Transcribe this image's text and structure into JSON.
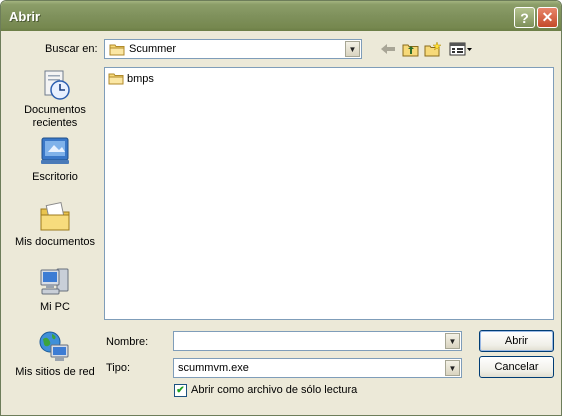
{
  "window": {
    "title": "Abrir"
  },
  "toolbar": {
    "look_in_label": "Buscar en:",
    "look_in_value": "Scummer"
  },
  "places": [
    {
      "label_line1": "Documentos",
      "label_line2": "recientes",
      "icon": "recent-documents-icon"
    },
    {
      "label_line1": "Escritorio",
      "label_line2": "",
      "icon": "desktop-icon"
    },
    {
      "label_line1": "Mis documentos",
      "label_line2": "",
      "icon": "my-documents-icon"
    },
    {
      "label_line1": "Mi PC",
      "label_line2": "",
      "icon": "my-computer-icon"
    },
    {
      "label_line1": "Mis sitios de red",
      "label_line2": "",
      "icon": "network-places-icon"
    }
  ],
  "files": [
    {
      "name": "bmps",
      "icon": "folder-icon"
    }
  ],
  "filename": {
    "label": "Nombre:",
    "value": ""
  },
  "filetype": {
    "label": "Tipo:",
    "value": "scummvm.exe"
  },
  "readonly": {
    "label": "Abrir como archivo de sólo lectura",
    "checked": true
  },
  "buttons": {
    "open": "Abrir",
    "cancel": "Cancelar"
  }
}
